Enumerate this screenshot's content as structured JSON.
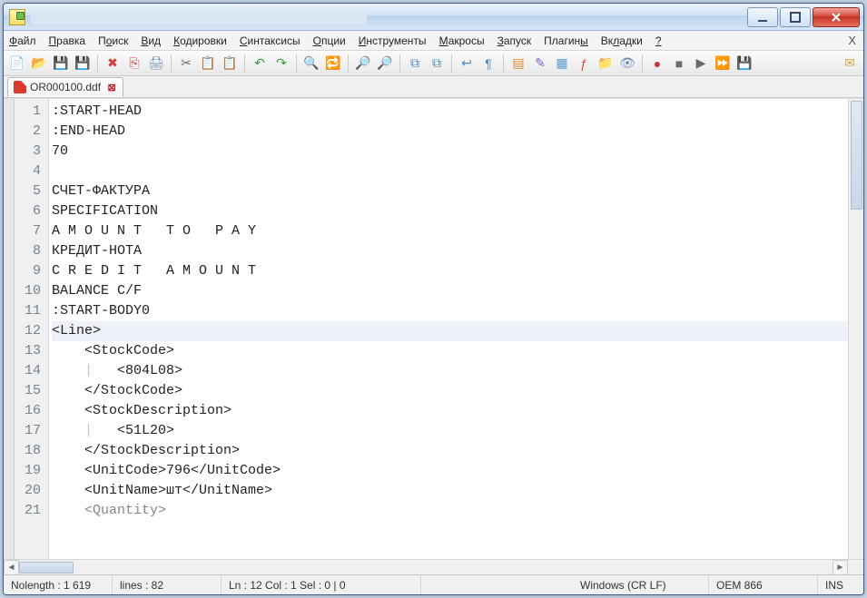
{
  "window_controls": {
    "min": "—",
    "max": "▢",
    "close": "X"
  },
  "menu": [
    {
      "label": "Файл",
      "u": "Ф"
    },
    {
      "label": "Правка",
      "u": "П"
    },
    {
      "label": "Поиск",
      "u": "о"
    },
    {
      "label": "Вид",
      "u": "В"
    },
    {
      "label": "Кодировки",
      "u": "К"
    },
    {
      "label": "Синтаксисы",
      "u": "С"
    },
    {
      "label": "Опции",
      "u": "О"
    },
    {
      "label": "Инструменты",
      "u": "И"
    },
    {
      "label": "Макросы",
      "u": "М"
    },
    {
      "label": "Запуск",
      "u": "З"
    },
    {
      "label": "Плагины",
      "u": "ы"
    },
    {
      "label": "Вкладки",
      "u": "л"
    },
    {
      "label": "?",
      "u": "?"
    }
  ],
  "tab": {
    "name": "OR000100.ddf"
  },
  "lines": [
    {
      "n": 1,
      "t": ":START-HEAD"
    },
    {
      "n": 2,
      "t": ":END-HEAD"
    },
    {
      "n": 3,
      "t": "70"
    },
    {
      "n": 4,
      "t": ""
    },
    {
      "n": 5,
      "t": "СЧЕТ-ФАКТУРА"
    },
    {
      "n": 6,
      "t": "SPECIFICATION"
    },
    {
      "n": 7,
      "t": "A M O U N T   T O   P A Y"
    },
    {
      "n": 8,
      "t": "КРЕДИТ-НОТА"
    },
    {
      "n": 9,
      "t": "C R E D I T   A M O U N T"
    },
    {
      "n": 10,
      "t": "BALANCE C/F"
    },
    {
      "n": 11,
      "t": ":START-BODY0"
    },
    {
      "n": 12,
      "t": "<Line>",
      "hl": true
    },
    {
      "n": 13,
      "t": "    <StockCode>"
    },
    {
      "n": 14,
      "t": "        <804L08>",
      "guide": true
    },
    {
      "n": 15,
      "t": "    </StockCode>"
    },
    {
      "n": 16,
      "t": "    <StockDescription>"
    },
    {
      "n": 17,
      "t": "        <51L20>",
      "guide": true
    },
    {
      "n": 18,
      "t": "    </StockDescription>"
    },
    {
      "n": 19,
      "t": "    <UnitCode>796</UnitCode>"
    },
    {
      "n": 20,
      "t": "    <UnitName>шт</UnitName>"
    },
    {
      "n": 21,
      "t": "    <Quantity>",
      "cut": true
    }
  ],
  "status": {
    "length": "Nolength : 1 619",
    "lines": "lines : 82",
    "pos": "Ln : 12   Col : 1   Sel : 0 | 0",
    "eol": "Windows (CR LF)",
    "enc": "OEM 866",
    "mode": "INS"
  },
  "toolbar_icons": [
    {
      "name": "new-file-icon",
      "g": "📄",
      "c": "#6fa84a"
    },
    {
      "name": "open-file-icon",
      "g": "📂",
      "c": "#d9a33a"
    },
    {
      "name": "save-icon",
      "g": "💾",
      "c": "#3a74c4"
    },
    {
      "name": "save-all-icon",
      "g": "💾",
      "c": "#3a74c4"
    },
    {
      "name": "sep"
    },
    {
      "name": "close-file-icon",
      "g": "✖",
      "c": "#c44"
    },
    {
      "name": "close-all-icon",
      "g": "⎘",
      "c": "#c44"
    },
    {
      "name": "print-icon",
      "g": "🖨",
      "c": "#6a8eb8"
    },
    {
      "name": "sep"
    },
    {
      "name": "cut-icon",
      "g": "✂",
      "c": "#6b6b6b"
    },
    {
      "name": "copy-icon",
      "g": "📋",
      "c": "#c9a24a"
    },
    {
      "name": "paste-icon",
      "g": "📋",
      "c": "#c9a24a"
    },
    {
      "name": "sep"
    },
    {
      "name": "undo-icon",
      "g": "↶",
      "c": "#3a9a3a"
    },
    {
      "name": "redo-icon",
      "g": "↷",
      "c": "#3a9a3a"
    },
    {
      "name": "sep"
    },
    {
      "name": "find-icon",
      "g": "🔍",
      "c": "#3a74c4"
    },
    {
      "name": "replace-icon",
      "g": "🔁",
      "c": "#c48a2a"
    },
    {
      "name": "sep"
    },
    {
      "name": "zoom-in-icon",
      "g": "🔎",
      "c": "#5a9a5a"
    },
    {
      "name": "zoom-out-icon",
      "g": "🔎",
      "c": "#c47a4a"
    },
    {
      "name": "sep"
    },
    {
      "name": "sync-h-icon",
      "g": "⧉",
      "c": "#4a8ac4"
    },
    {
      "name": "sync-v-icon",
      "g": "⧉",
      "c": "#4a8ac4"
    },
    {
      "name": "sep"
    },
    {
      "name": "wordwrap-icon",
      "g": "↩",
      "c": "#4a8ac4"
    },
    {
      "name": "whitespace-icon",
      "g": "¶",
      "c": "#4a8ac4"
    },
    {
      "name": "sep"
    },
    {
      "name": "indent-guide-icon",
      "g": "▤",
      "c": "#d98a2a"
    },
    {
      "name": "lang-icon",
      "g": "✎",
      "c": "#6a6ac4"
    },
    {
      "name": "doc-map-icon",
      "g": "▦",
      "c": "#5a9ad4"
    },
    {
      "name": "function-list-icon",
      "g": "ƒ",
      "c": "#d94a3a"
    },
    {
      "name": "folder-icon",
      "g": "📁",
      "c": "#d9a33a"
    },
    {
      "name": "monitor-icon",
      "g": "👁",
      "c": "#6a8eb8"
    },
    {
      "name": "sep"
    },
    {
      "name": "record-icon",
      "g": "●",
      "c": "#c43a3a"
    },
    {
      "name": "stop-icon",
      "g": "■",
      "c": "#6a6a6a"
    },
    {
      "name": "play-icon",
      "g": "▶",
      "c": "#6a6a6a"
    },
    {
      "name": "fast-icon",
      "g": "⏩",
      "c": "#4a8ac4"
    },
    {
      "name": "save-macro-icon",
      "g": "💾",
      "c": "#4a8ac4"
    },
    {
      "name": "sep-flex"
    },
    {
      "name": "plugin-icon",
      "g": "✉",
      "c": "#d9a33a"
    }
  ]
}
